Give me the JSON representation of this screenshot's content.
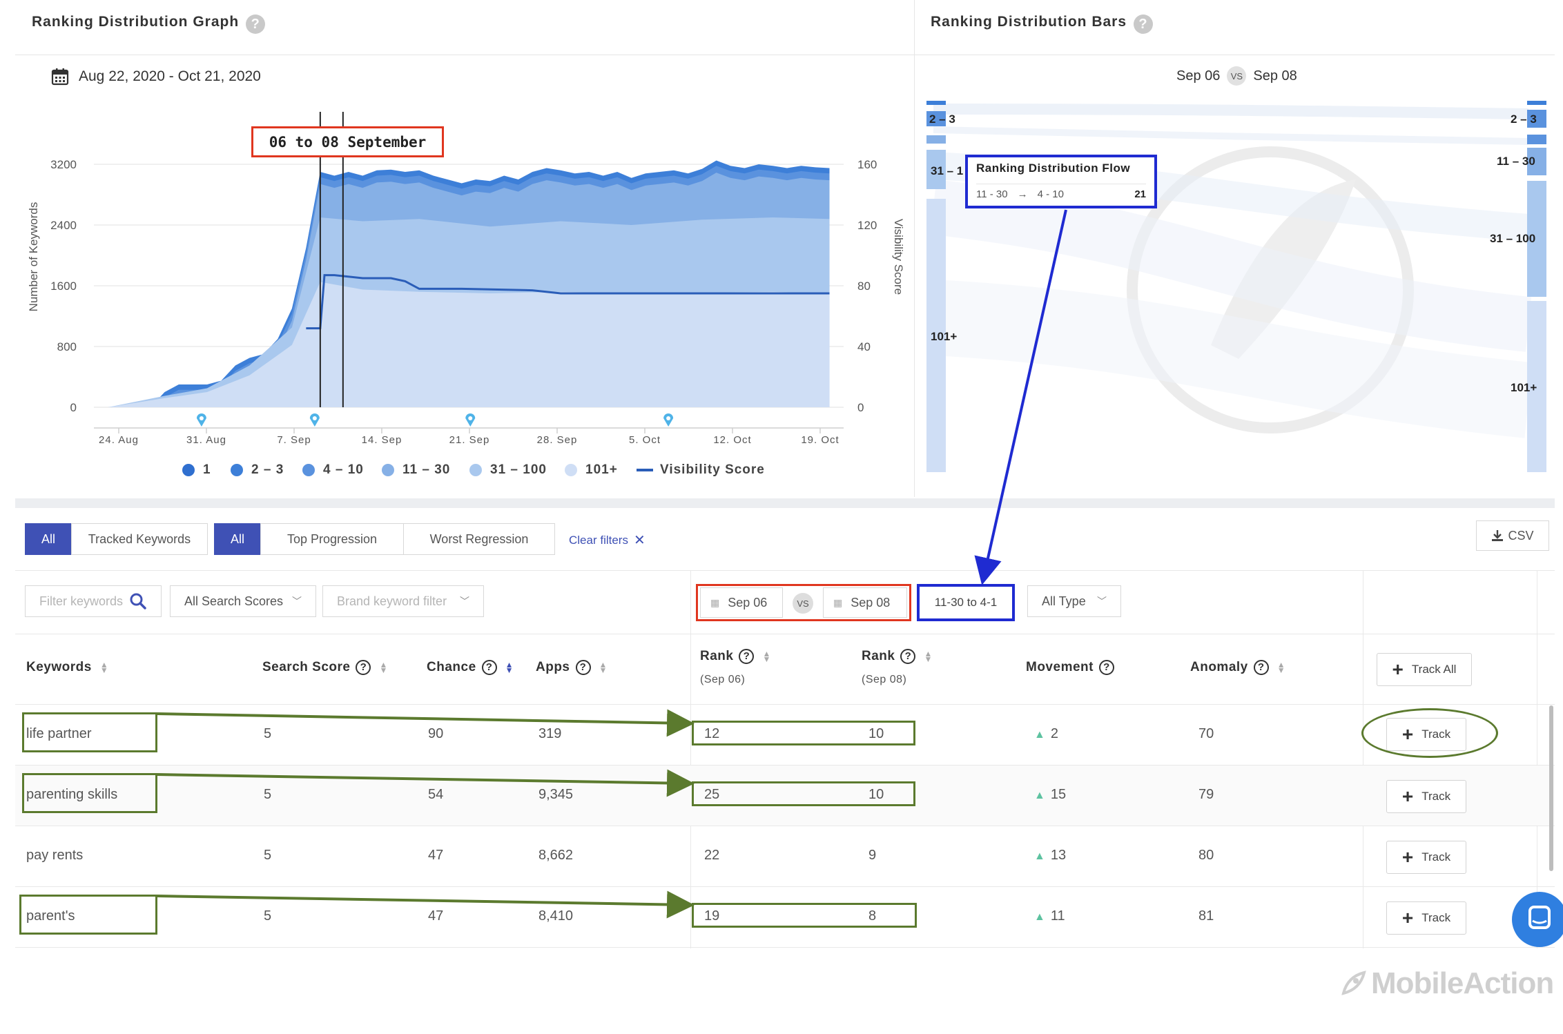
{
  "graph_panel": {
    "title": "Ranking Distribution Graph",
    "date_range": "Aug 22, 2020 - Oct 21, 2020",
    "annotation": "06 to 08 September",
    "y_left_label": "Number of Keywords",
    "y_right_label": "Visibility Score"
  },
  "chart_data": {
    "type": "area",
    "x_ticks": [
      "24. Aug",
      "31. Aug",
      "7. Sep",
      "14. Sep",
      "21. Sep",
      "28. Sep",
      "5. Oct",
      "12. Oct",
      "19. Oct"
    ],
    "y_left_ticks": [
      "3200",
      "2400",
      "1600",
      "800",
      "0"
    ],
    "y_right_ticks": [
      "160",
      "120",
      "80",
      "40",
      "0"
    ],
    "ylim_left": [
      0,
      4000
    ],
    "ylim_right": [
      0,
      200
    ],
    "legend": [
      {
        "label": "1",
        "color": "#2f6fcf"
      },
      {
        "label": "2 – 3",
        "color": "#3d7fd8"
      },
      {
        "label": "4 – 10",
        "color": "#5a92de"
      },
      {
        "label": "11 – 30",
        "color": "#86b0e6"
      },
      {
        "label": "31 – 100",
        "color": "#a9c8ee"
      },
      {
        "label": "101+",
        "color": "#cfdef5"
      },
      {
        "label": "Visibility Score",
        "color": "#2a5db8"
      }
    ],
    "stack_top": [
      [
        23,
        0
      ],
      [
        24,
        0
      ],
      [
        25,
        0
      ],
      [
        26,
        0
      ],
      [
        27,
        200
      ],
      [
        28,
        300
      ],
      [
        29,
        300
      ],
      [
        30,
        300
      ],
      [
        31,
        350
      ],
      [
        32,
        550
      ],
      [
        33,
        650
      ],
      [
        34,
        700
      ],
      [
        35,
        900
      ],
      [
        36,
        1300
      ],
      [
        37,
        2100
      ],
      [
        38,
        3100
      ],
      [
        39,
        3050
      ],
      [
        40,
        3100
      ],
      [
        41,
        3050
      ],
      [
        42,
        3120
      ],
      [
        43,
        3130
      ],
      [
        44,
        3100
      ],
      [
        45,
        3120
      ],
      [
        46,
        3050
      ],
      [
        47,
        3000
      ],
      [
        48,
        2950
      ],
      [
        49,
        3000
      ],
      [
        50,
        2980
      ],
      [
        51,
        3050
      ],
      [
        52,
        3000
      ],
      [
        53,
        3100
      ],
      [
        54,
        3150
      ],
      [
        55,
        3120
      ],
      [
        56,
        3080
      ],
      [
        57,
        3100
      ],
      [
        58,
        3050
      ],
      [
        59,
        3100
      ],
      [
        60,
        3020
      ],
      [
        61,
        3080
      ],
      [
        62,
        3100
      ],
      [
        63,
        3120
      ],
      [
        64,
        3080
      ],
      [
        65,
        3140
      ],
      [
        66,
        3250
      ],
      [
        67,
        3180
      ],
      [
        68,
        3150
      ],
      [
        69,
        3200
      ],
      [
        70,
        3180
      ],
      [
        71,
        3150
      ],
      [
        72,
        3180
      ],
      [
        73,
        3160
      ],
      [
        74,
        3150
      ]
    ],
    "band_31_100_top": [
      [
        23,
        0
      ],
      [
        27,
        150
      ],
      [
        30,
        250
      ],
      [
        33,
        550
      ],
      [
        36,
        1050
      ],
      [
        38,
        2500
      ],
      [
        41,
        2450
      ],
      [
        45,
        2480
      ],
      [
        50,
        2380
      ],
      [
        55,
        2450
      ],
      [
        60,
        2400
      ],
      [
        65,
        2470
      ],
      [
        70,
        2500
      ],
      [
        74,
        2480
      ]
    ],
    "band_101_top": [
      [
        23,
        0
      ],
      [
        27,
        120
      ],
      [
        30,
        200
      ],
      [
        33,
        420
      ],
      [
        36,
        820
      ],
      [
        38,
        1650
      ],
      [
        41,
        1550
      ],
      [
        45,
        1520
      ],
      [
        50,
        1500
      ],
      [
        55,
        1520
      ],
      [
        60,
        1500
      ],
      [
        65,
        1510
      ],
      [
        70,
        1520
      ],
      [
        74,
        1500
      ]
    ],
    "visibility_score": [
      [
        37,
        52
      ],
      [
        38,
        52
      ],
      [
        38.3,
        87
      ],
      [
        39,
        87
      ],
      [
        41,
        85
      ],
      [
        43,
        85
      ],
      [
        44,
        83
      ],
      [
        45,
        78
      ],
      [
        48,
        78
      ],
      [
        53,
        77
      ],
      [
        55,
        75
      ],
      [
        60,
        75
      ],
      [
        65,
        75
      ],
      [
        70,
        75
      ],
      [
        74,
        75
      ]
    ],
    "event_markers": [
      30,
      38,
      49,
      63
    ],
    "selected_range": [
      38,
      40
    ]
  },
  "bars_panel": {
    "title": "Ranking Distribution Bars",
    "compare_from": "Sep 06",
    "compare_to": "Sep 08",
    "vs": "VS",
    "left_labels": [
      "2 – 3",
      "31 – 1",
      "101+"
    ],
    "right_labels": [
      "2 – 3",
      "11 – 30",
      "31 – 100",
      "101+"
    ],
    "tooltip": {
      "title": "Ranking Distribution Flow",
      "from": "11 - 30",
      "arrow": "→",
      "to": "4 - 10",
      "count": "21"
    }
  },
  "filters": {
    "group1": [
      "All",
      "Tracked Keywords"
    ],
    "group2": [
      "All",
      "Top Progression",
      "Worst Regression"
    ],
    "clear_filters": "Clear filters",
    "csv": "CSV",
    "filter_keywords_placeholder": "Filter keywords",
    "search_scores": "All Search Scores",
    "brand_filter_placeholder": "Brand keyword filter",
    "date_from": "Sep 06",
    "vs": "VS",
    "date_to": "Sep 08",
    "rank_range": "11-30 to 4-1",
    "type": "All Type"
  },
  "table": {
    "headers": {
      "keywords": "Keywords",
      "search_score": "Search Score",
      "chance": "Chance",
      "apps": "Apps",
      "rank1": "Rank",
      "rank1_sub": "(Sep 06)",
      "rank2": "Rank",
      "rank2_sub": "(Sep 08)",
      "movement": "Movement",
      "anomaly": "Anomaly",
      "track_all": "Track All"
    },
    "rows": [
      {
        "keyword": "life partner",
        "search_score": "5",
        "chance": "90",
        "apps": "319",
        "rank1": "12",
        "rank2": "10",
        "movement": "2",
        "anomaly": "70",
        "track": "Track"
      },
      {
        "keyword": "parenting skills",
        "search_score": "5",
        "chance": "54",
        "apps": "9,345",
        "rank1": "25",
        "rank2": "10",
        "movement": "15",
        "anomaly": "79",
        "track": "Track"
      },
      {
        "keyword": "pay rents",
        "search_score": "5",
        "chance": "47",
        "apps": "8,662",
        "rank1": "22",
        "rank2": "9",
        "movement": "13",
        "anomaly": "80",
        "track": "Track"
      },
      {
        "keyword": "parent's",
        "search_score": "5",
        "chance": "47",
        "apps": "8,410",
        "rank1": "19",
        "rank2": "8",
        "movement": "11",
        "anomaly": "81",
        "track": "Track"
      }
    ]
  },
  "watermark": "MobileAction",
  "colors": {
    "primary": "#3f51b5",
    "annotation_red": "#e0361f",
    "annotation_blue": "#1f2bd1",
    "annotation_green": "#5b7a2e",
    "movement_up": "#5dc2a0"
  }
}
